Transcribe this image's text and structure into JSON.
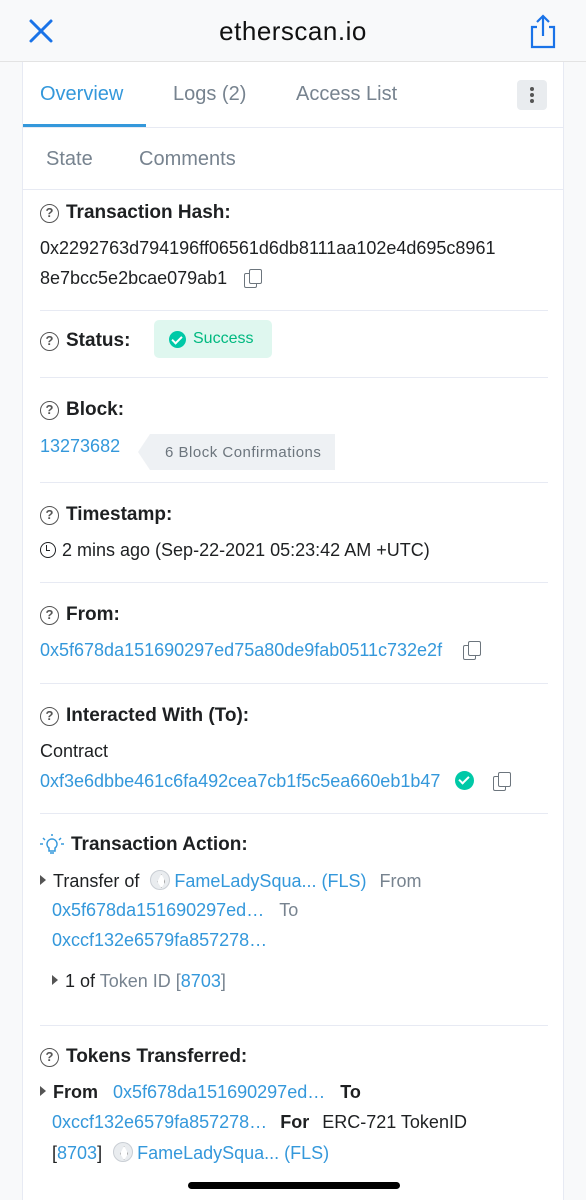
{
  "topbar": {
    "title": "etherscan.io",
    "close_icon": "close-icon",
    "share_icon": "share-icon"
  },
  "tabs": {
    "overview": "Overview",
    "logs": "Logs (2)",
    "access_list": "Access List",
    "state": "State",
    "comments": "Comments"
  },
  "tx_hash": {
    "label": "Transaction Hash:",
    "line1": "0x2292763d794196ff06561d6db8111aa102e4d695c8961",
    "line2": "8e7bcc5e2bcae079ab1"
  },
  "status": {
    "label": "Status:",
    "value": "Success",
    "color": "#00c9a7"
  },
  "block": {
    "label": "Block:",
    "number": "13273682",
    "confirmations": "6 Block Confirmations"
  },
  "timestamp": {
    "label": "Timestamp:",
    "value": "2 mins ago (Sep-22-2021 05:23:42 AM +UTC)"
  },
  "from": {
    "label": "From:",
    "address": "0x5f678da151690297ed75a80de9fab0511c732e2f"
  },
  "interacted": {
    "label": "Interacted With (To):",
    "type": "Contract",
    "address": "0xf3e6dbbe461c6fa492cea7cb1f5c5ea660eb1b47"
  },
  "action": {
    "label": "Transaction Action:",
    "transfer_of": "Transfer of",
    "token": "FameLadySqua... (FLS)",
    "from_word": "From",
    "from_addr": "0x5f678da151690297ed…",
    "to_word": "To",
    "to_addr": "0xccf132e6579fa857278…",
    "count": "1 of",
    "token_id_label": "Token ID",
    "bracket_open": "[",
    "token_id": "8703",
    "bracket_close": "]"
  },
  "tokens": {
    "label": "Tokens Transferred:",
    "from_word": "From",
    "from_addr": "0x5f678da151690297ed…",
    "to_word": "To",
    "to_addr": "0xccf132e6579fa857278…",
    "for_word": "For",
    "erc": "ERC-721 TokenID",
    "bracket_open": "[",
    "token_id": "8703",
    "bracket_close": "]",
    "token": "FameLadySqua... (FLS)"
  },
  "colors": {
    "link": "#3498db",
    "success_bg": "#dff7ef",
    "text": "#1e2022"
  }
}
